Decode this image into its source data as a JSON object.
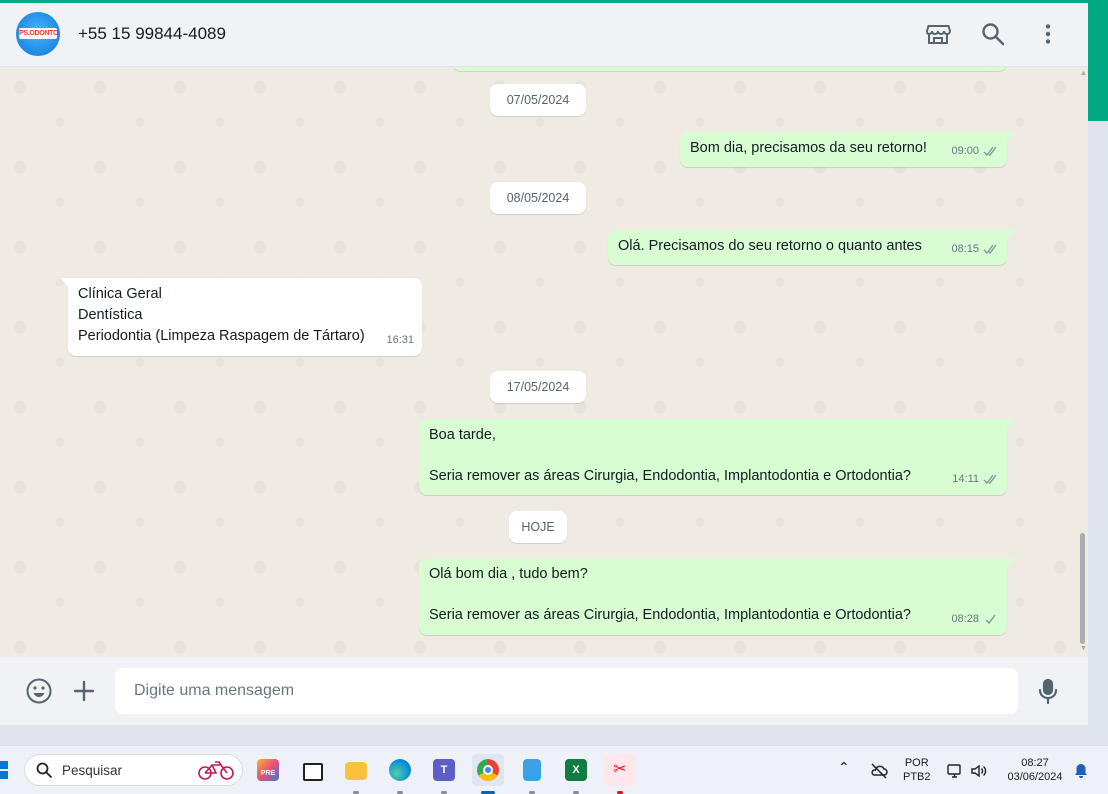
{
  "header": {
    "contact_name": "+55 15 99844-4089",
    "avatar_logo_text": "PS.ODONTO",
    "icons": [
      "store-icon",
      "search-icon",
      "menu-icon"
    ]
  },
  "messages": [
    {
      "type": "date",
      "text": "07/05/2024"
    },
    {
      "type": "out",
      "lines": [
        "Bom dia, precisamos da seu retorno!"
      ],
      "time": "09:00",
      "status": "read"
    },
    {
      "type": "date",
      "text": "08/05/2024"
    },
    {
      "type": "out",
      "lines": [
        "Olá. Precisamos do seu retorno o quanto antes"
      ],
      "time": "08:15",
      "status": "read"
    },
    {
      "type": "in",
      "lines": [
        "Clínica Geral",
        "Dentística",
        "Periodontia (Limpeza Raspagem de Tártaro)"
      ],
      "time": "16:31"
    },
    {
      "type": "date",
      "text": "17/05/2024"
    },
    {
      "type": "out",
      "lines": [
        "Boa tarde,",
        "",
        "Seria remover as áreas Cirurgia, Endodontia, Implantodontia e Ortodontia?"
      ],
      "time": "14:11",
      "status": "read"
    },
    {
      "type": "date",
      "text": "HOJE"
    },
    {
      "type": "out",
      "lines": [
        "Olá bom dia , tudo bem?",
        "",
        "Seria remover as áreas Cirurgia, Endodontia, Implantodontia e Ortodontia?"
      ],
      "time": "08:28",
      "status": "sent"
    }
  ],
  "compose": {
    "placeholder": "Digite uma mensagem",
    "icons": [
      "emoji-icon",
      "attach-plus-icon",
      "microphone-icon"
    ]
  },
  "taskbar": {
    "search_placeholder": "Pesquisar",
    "apps": [
      "copilot-pre-icon",
      "task-view-icon",
      "file-explorer-icon",
      "edge-icon",
      "teams-icon",
      "chrome-icon",
      "notepad-icon",
      "excel-icon",
      "snipping-tool-icon"
    ],
    "active_app": "chrome-icon",
    "language": "POR",
    "keyboard": "PTB2",
    "time": "08:27",
    "date": "03/06/2024"
  },
  "colors": {
    "accent": "#00a884",
    "outgoing_bubble": "#d9fdd3",
    "incoming_bubble": "#ffffff",
    "read_tick": "#8696a0",
    "chat_bg": "#efeae2"
  }
}
